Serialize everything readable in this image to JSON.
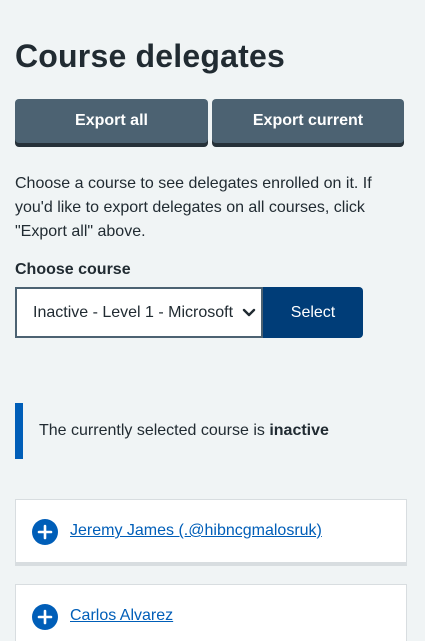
{
  "page": {
    "title": "Course delegates"
  },
  "actions": {
    "export_all": "Export all",
    "export_current": "Export current"
  },
  "intro": {
    "text": "Choose a course to see delegates enrolled on it. If you'd like to export delegates on all courses, click \"Export all\" above."
  },
  "course_select": {
    "label": "Choose course",
    "selected": "Inactive - Level 1 - Microsoft",
    "button": "Select"
  },
  "status_inset": {
    "prefix": "The currently selected course is ",
    "status": "inactive"
  },
  "delegates": [
    {
      "name": "Jeremy James (.@hibncgmalosruk)"
    },
    {
      "name": "Carlos Alvarez"
    }
  ],
  "colors": {
    "background": "#f0f4f5",
    "secondary_button": "#4c6272",
    "primary_button": "#003d78",
    "link": "#005eb8",
    "inset_bar": "#005eb8"
  },
  "icons": {
    "expand": "plus-circle-icon",
    "select": "chevron-down-icon"
  }
}
